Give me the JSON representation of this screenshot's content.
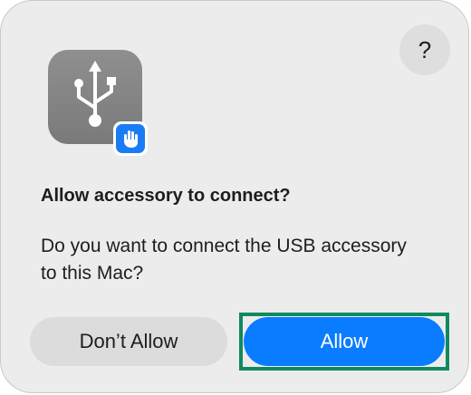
{
  "dialog": {
    "help_label": "?",
    "title": "Allow accessory to connect?",
    "message": "Do you want to connect the USB accessory to this Mac?",
    "icon": "usb-icon",
    "badge_icon": "hand-icon",
    "buttons": {
      "dont_allow_label": "Don’t Allow",
      "allow_label": "Allow"
    }
  },
  "colors": {
    "dialog_background": "#ececec",
    "primary_button": "#0a7cff",
    "secondary_button": "#dcdcdc",
    "badge": "#1a7cf5",
    "focus_highlight": "#0f8a5f"
  }
}
